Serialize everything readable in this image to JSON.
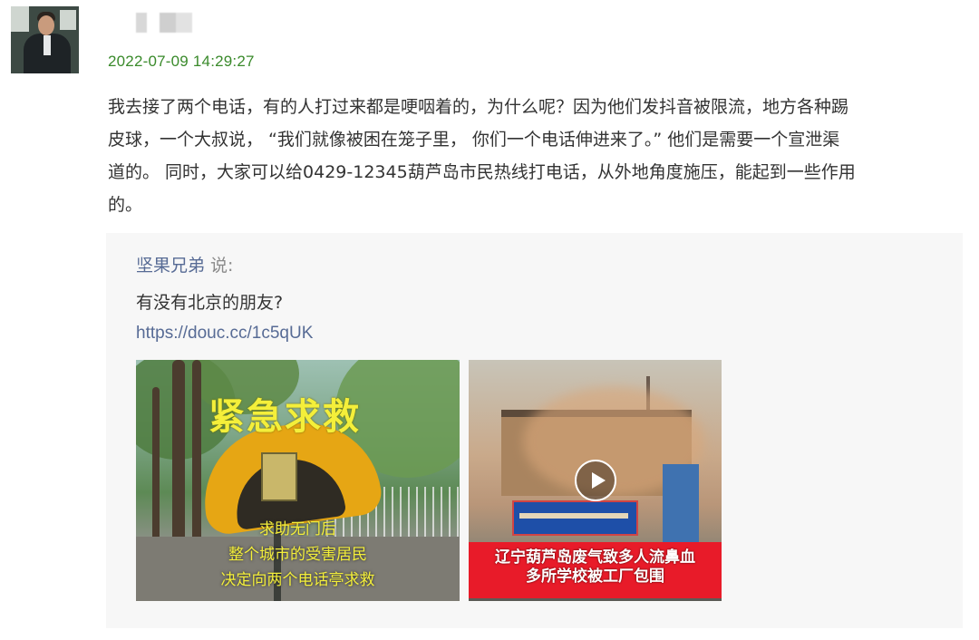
{
  "post": {
    "timestamp": "2022-07-09 14:29:27",
    "lines": [
      "我去接了两个电话，有的人打过来都是哽咽着的，为什么呢？因为他们发抖音被限流，地方各种踢",
      "皮球，一个大叔说，  “我们就像被困在笼子里，  你们一个电话伸进来了。” 他们是需要一个宣泄渠",
      "道的。 同时，大家可以给0429-12345葫芦岛市民热线打电话，从外地角度施压，能起到一些作用",
      "的。"
    ]
  },
  "quote": {
    "author": "坚果兄弟",
    "says": "说:",
    "text": "有没有北京的朋友?",
    "link": "https://douc.cc/1c5qUK"
  },
  "thumbnails": [
    {
      "headline": "紧急求救",
      "caption_lines": [
        "求助无门后",
        "整个城市的受害居民",
        "决定向两个电话亭求救"
      ]
    },
    {
      "banner_lines": [
        "辽宁葫芦岛废气致多人流鼻血",
        "多所学校被工厂包围"
      ],
      "icon": "play-icon"
    }
  ],
  "colors": {
    "timestamp": "#3a8a2b",
    "link": "#576b95",
    "quote_bg": "#f7f7f7",
    "headline_yellow": "#f4ef3a",
    "banner_red": "#e81b29"
  }
}
